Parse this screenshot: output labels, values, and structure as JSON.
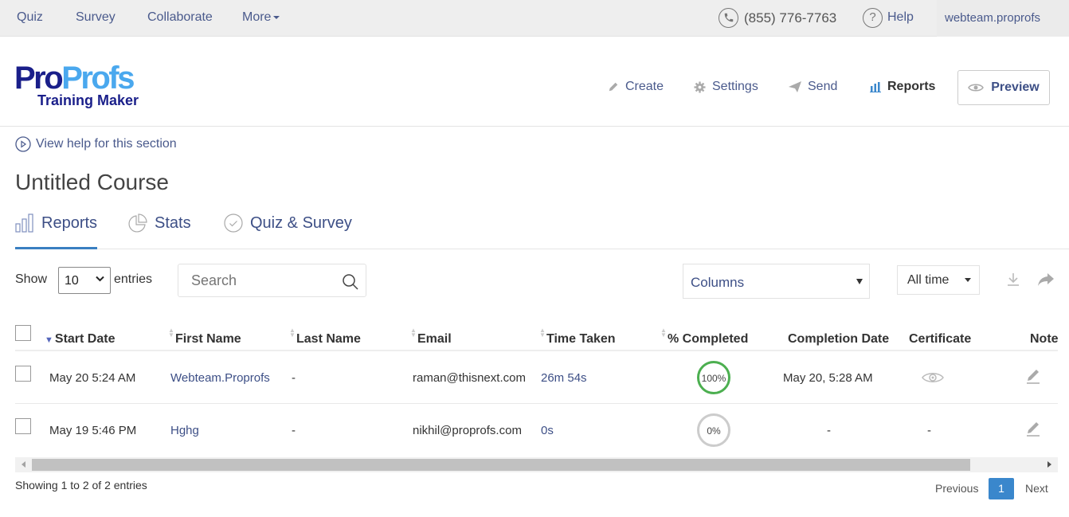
{
  "topbar": {
    "nav": [
      {
        "label": "Quiz"
      },
      {
        "label": "Survey"
      },
      {
        "label": "Collaborate"
      },
      {
        "label": "More"
      }
    ],
    "phone": "(855) 776-7763",
    "help": "Help",
    "user": "webteam.proprofs"
  },
  "header": {
    "logo": {
      "part1": "Pro",
      "part2": "Profs",
      "subtitle": "Training Maker"
    },
    "nav": [
      {
        "label": "Create",
        "icon": "pencil-icon"
      },
      {
        "label": "Settings",
        "icon": "gear-icon"
      },
      {
        "label": "Send",
        "icon": "paper-plane-icon"
      },
      {
        "label": "Reports",
        "icon": "bar-chart-icon",
        "active": true
      }
    ],
    "preview": "Preview"
  },
  "help_link": "View help for this section",
  "page_title": "Untitled Course",
  "tabs": [
    {
      "label": "Reports",
      "active": true
    },
    {
      "label": "Stats"
    },
    {
      "label": "Quiz & Survey"
    }
  ],
  "controls": {
    "show_label": "Show",
    "entries_value": "10",
    "entries_label": "entries",
    "search_placeholder": "Search",
    "columns_label": "Columns",
    "time_filter": "All time"
  },
  "table": {
    "columns": [
      "Start Date",
      "First Name",
      "Last Name",
      "Email",
      "Time Taken",
      "% Completed",
      "Completion Date",
      "Certificate",
      "Note"
    ],
    "sorted_column": "Start Date",
    "sort_direction": "desc",
    "rows": [
      {
        "start_date": "May 20 5:24 AM",
        "first_name": "Webteam.Proprofs",
        "last_name": "-",
        "email": "raman@thisnext.com",
        "time_taken": "26m 54s",
        "completed": "100%",
        "completed_value": 100,
        "completion_date": "May 20, 5:28 AM",
        "certificate": "",
        "certificate_icon": "eye-icon"
      },
      {
        "start_date": "May 19 5:46 PM",
        "first_name": "Hghg",
        "last_name": "-",
        "email": "nikhil@proprofs.com",
        "time_taken": "0s",
        "completed": "0%",
        "completed_value": 0,
        "completion_date": "-",
        "certificate": "-"
      }
    ]
  },
  "footer": {
    "info": "Showing 1 to 2 of 2 entries",
    "previous": "Previous",
    "current_page": "1",
    "next": "Next"
  },
  "colors": {
    "accent": "#3a87cc",
    "link": "#3d4f86",
    "complete": "#4caf50",
    "incomplete": "#cccccc"
  }
}
